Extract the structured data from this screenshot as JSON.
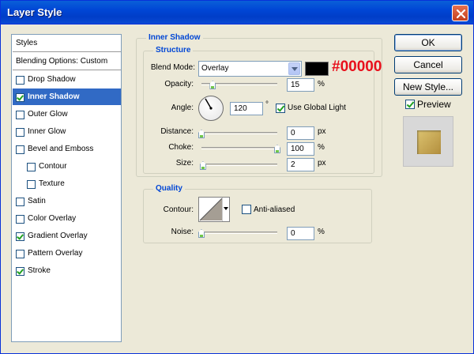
{
  "window": {
    "title": "Layer Style"
  },
  "styles_list": {
    "header": "Styles",
    "blending": "Blending Options: Custom",
    "items": [
      {
        "label": "Drop Shadow",
        "checked": false
      },
      {
        "label": "Inner Shadow",
        "checked": true,
        "selected": true
      },
      {
        "label": "Outer Glow",
        "checked": false
      },
      {
        "label": "Inner Glow",
        "checked": false
      },
      {
        "label": "Bevel and Emboss",
        "checked": false
      },
      {
        "label": "Contour",
        "checked": false,
        "indent": true
      },
      {
        "label": "Texture",
        "checked": false,
        "indent": true
      },
      {
        "label": "Satin",
        "checked": false
      },
      {
        "label": "Color Overlay",
        "checked": false
      },
      {
        "label": "Gradient Overlay",
        "checked": true
      },
      {
        "label": "Pattern Overlay",
        "checked": false
      },
      {
        "label": "Stroke",
        "checked": true
      }
    ]
  },
  "inner_shadow": {
    "title": "Inner Shadow",
    "structure": {
      "title": "Structure",
      "blend_mode_label": "Blend Mode:",
      "blend_mode_value": "Overlay",
      "shadow_color": "#000000",
      "color_annotation": "#00000",
      "opacity_label": "Opacity:",
      "opacity_value": "15",
      "opacity_unit": "%",
      "opacity_percent": 15,
      "angle_label": "Angle:",
      "angle_value": "120",
      "angle_unit": "°",
      "use_global_light_label": "Use Global Light",
      "use_global_light_checked": true,
      "distance_label": "Distance:",
      "distance_value": "0",
      "distance_unit": "px",
      "distance_fraction": 0,
      "choke_label": "Choke:",
      "choke_value": "100",
      "choke_unit": "%",
      "choke_percent": 100,
      "size_label": "Size:",
      "size_value": "2",
      "size_unit": "px",
      "size_fraction": 0.02
    },
    "quality": {
      "title": "Quality",
      "contour_label": "Contour:",
      "anti_aliased_label": "Anti-aliased",
      "anti_aliased_checked": false,
      "noise_label": "Noise:",
      "noise_value": "0",
      "noise_unit": "%",
      "noise_percent": 0
    }
  },
  "buttons": {
    "ok": "OK",
    "cancel": "Cancel",
    "new_style": "New Style...",
    "preview_label": "Preview",
    "preview_checked": true
  }
}
